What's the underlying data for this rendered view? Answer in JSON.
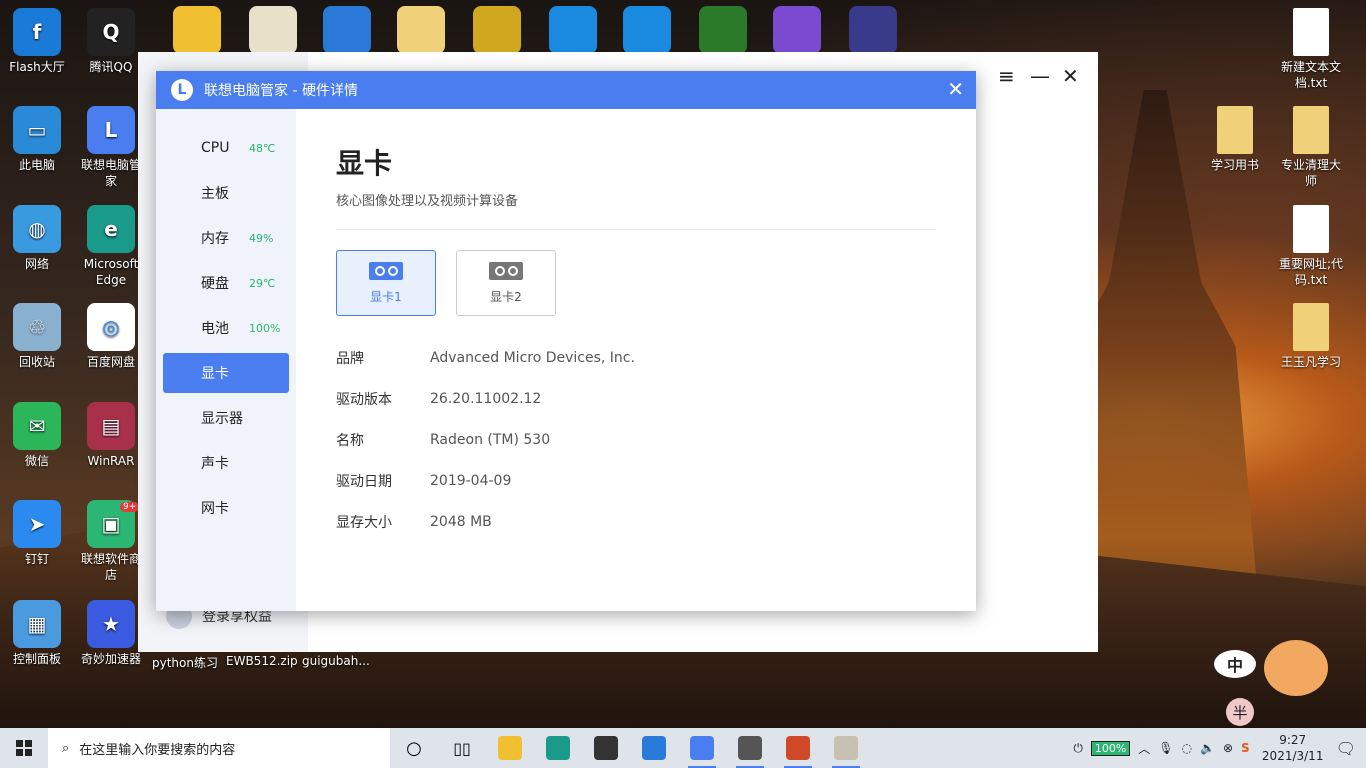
{
  "desktop": {
    "left_icons": [
      {
        "label": "Flash大厅",
        "color": "#1a7ad8",
        "glyph": "f"
      },
      {
        "label": "腾讯QQ",
        "color": "#222",
        "glyph": "Q"
      },
      {
        "label": "此电脑",
        "color": "#2a8ad8",
        "glyph": "▭"
      },
      {
        "label": "联想电脑管家",
        "color": "#4a7ef0",
        "glyph": "L"
      },
      {
        "label": "网络",
        "color": "#3a9ae0",
        "glyph": "◍"
      },
      {
        "label": "Microsoft Edge",
        "color": "#1a9a8a",
        "glyph": "e"
      },
      {
        "label": "回收站",
        "color": "#8ab0d0",
        "glyph": "♲"
      },
      {
        "label": "百度网盘",
        "color": "#ffffff",
        "glyph": "◎"
      },
      {
        "label": "微信",
        "color": "#2bb65a",
        "glyph": "✉"
      },
      {
        "label": "WinRAR",
        "color": "#a8304a",
        "glyph": "▤"
      },
      {
        "label": "钉钉",
        "color": "#2a8af0",
        "glyph": "➤"
      },
      {
        "label": "联想软件商店",
        "color": "#2bb673",
        "glyph": "▣"
      },
      {
        "label": "控制面板",
        "color": "#4a9ae0",
        "glyph": "▦"
      },
      {
        "label": "奇妙加速器",
        "color": "#3a5ae0",
        "glyph": "★"
      }
    ],
    "top_icons": [
      {
        "color": "#f0c030"
      },
      {
        "color": "#e8e0c8"
      },
      {
        "color": "#2a78d8"
      },
      {
        "color": "#f0d078"
      },
      {
        "color": "#d0a820"
      },
      {
        "color": "#1a8ae0"
      },
      {
        "color": "#1a8ae0"
      },
      {
        "color": "#2a7a2a"
      },
      {
        "color": "#7a4ad0"
      },
      {
        "color": "#3a3a8a"
      }
    ],
    "bottom_labels": [
      "python练习",
      "EWB512.zip",
      "guigubah..."
    ],
    "right_icons": [
      {
        "label": "新建文本文档.txt",
        "color": "#ffffff"
      },
      {
        "label": "学习用书",
        "color": "#f0d078"
      },
      {
        "label": "专业清理大师",
        "color": "#f0d078"
      },
      {
        "label": "重要网址;代码.txt",
        "color": "#ffffff"
      },
      {
        "label": "王玉凡学习",
        "color": "#f0d078"
      }
    ],
    "badge": "9+"
  },
  "bg_window": {
    "menu_icon": "≡",
    "minimize_icon": "—",
    "close_icon": "✕",
    "login_text": "登录享权益"
  },
  "dialog": {
    "title": "联想电脑管家 - 硬件详情",
    "logo": "L",
    "close_icon": "✕",
    "nav": [
      {
        "label": "CPU",
        "value": "48℃"
      },
      {
        "label": "主板",
        "value": ""
      },
      {
        "label": "内存",
        "value": "49%"
      },
      {
        "label": "硬盘",
        "value": "29℃"
      },
      {
        "label": "电池",
        "value": "100%"
      },
      {
        "label": "显卡",
        "value": ""
      },
      {
        "label": "显示器",
        "value": ""
      },
      {
        "label": "声卡",
        "value": ""
      },
      {
        "label": "网卡",
        "value": ""
      }
    ],
    "heading": "显卡",
    "subheading": "核心图像处理以及视频计算设备",
    "cards": [
      {
        "label": "显卡1"
      },
      {
        "label": "显卡2"
      }
    ],
    "details": [
      {
        "key": "品牌",
        "value": "Advanced Micro Devices, Inc."
      },
      {
        "key": "驱动版本",
        "value": "26.20.11002.12"
      },
      {
        "key": "名称",
        "value": "Radeon (TM) 530"
      },
      {
        "key": "驱动日期",
        "value": "2019-04-09"
      },
      {
        "key": "显存大小",
        "value": "2048 MB"
      }
    ]
  },
  "taskbar": {
    "search_placeholder": "在这里输入你要搜索的内容",
    "apps": [
      {
        "name": "cortana",
        "color": "transparent"
      },
      {
        "name": "task-view",
        "color": "transparent"
      },
      {
        "name": "file-explorer",
        "color": "#f0c030"
      },
      {
        "name": "edge",
        "color": "#1a9a8a"
      },
      {
        "name": "store",
        "color": "#333"
      },
      {
        "name": "mail",
        "color": "#2a7ad8"
      },
      {
        "name": "lenovo-manager",
        "color": "#4a7ef0"
      },
      {
        "name": "app-game",
        "color": "#555"
      },
      {
        "name": "powerpoint",
        "color": "#d04a2a"
      },
      {
        "name": "app-photo",
        "color": "#c8c0b0"
      }
    ],
    "battery": "100%",
    "time": "9:27",
    "date": "2021/3/11",
    "ime_label": "中",
    "ime_mode": "半"
  }
}
